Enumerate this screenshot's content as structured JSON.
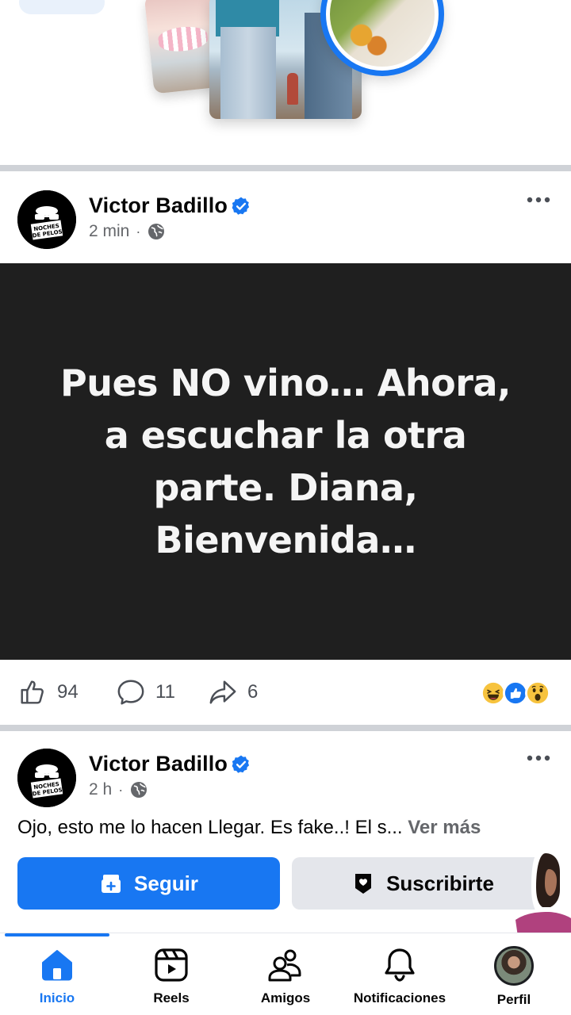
{
  "colors": {
    "accent": "#1877f2",
    "post_background": "#1f1f1f",
    "divider": "#cfd2d7",
    "secondary_text": "#65676b"
  },
  "posts": [
    {
      "author": "Victor Badillo",
      "verified": true,
      "time": "2 min",
      "audience_icon": "globe-icon",
      "avatar_text": [
        "NOCHES",
        "DE PELOS"
      ],
      "image_text": "Pues NO vino… Ahora, a escuchar la otra parte. Diana, Bienvenida…",
      "likes": "94",
      "comments": "11",
      "shares": "6",
      "reactions": [
        "haha",
        "like",
        "wow"
      ]
    },
    {
      "author": "Victor Badillo",
      "verified": true,
      "time": "2 h",
      "audience_icon": "globe-icon",
      "avatar_text": [
        "NOCHES",
        "DE PELOS"
      ],
      "snippet": "Ojo, esto me lo hacen Llegar. Es fake..! El s...",
      "see_more": "Ver más"
    }
  ],
  "buttons": {
    "follow": "Seguir",
    "subscribe": "Suscribirte"
  },
  "nav": [
    {
      "label": "Inicio",
      "icon": "home-icon",
      "active": true
    },
    {
      "label": "Reels",
      "icon": "reels-icon",
      "active": false
    },
    {
      "label": "Amigos",
      "icon": "friends-icon",
      "active": false
    },
    {
      "label": "Notificaciones",
      "icon": "bell-icon",
      "active": false
    },
    {
      "label": "Perfil",
      "icon": "profile-avatar",
      "active": false
    }
  ]
}
